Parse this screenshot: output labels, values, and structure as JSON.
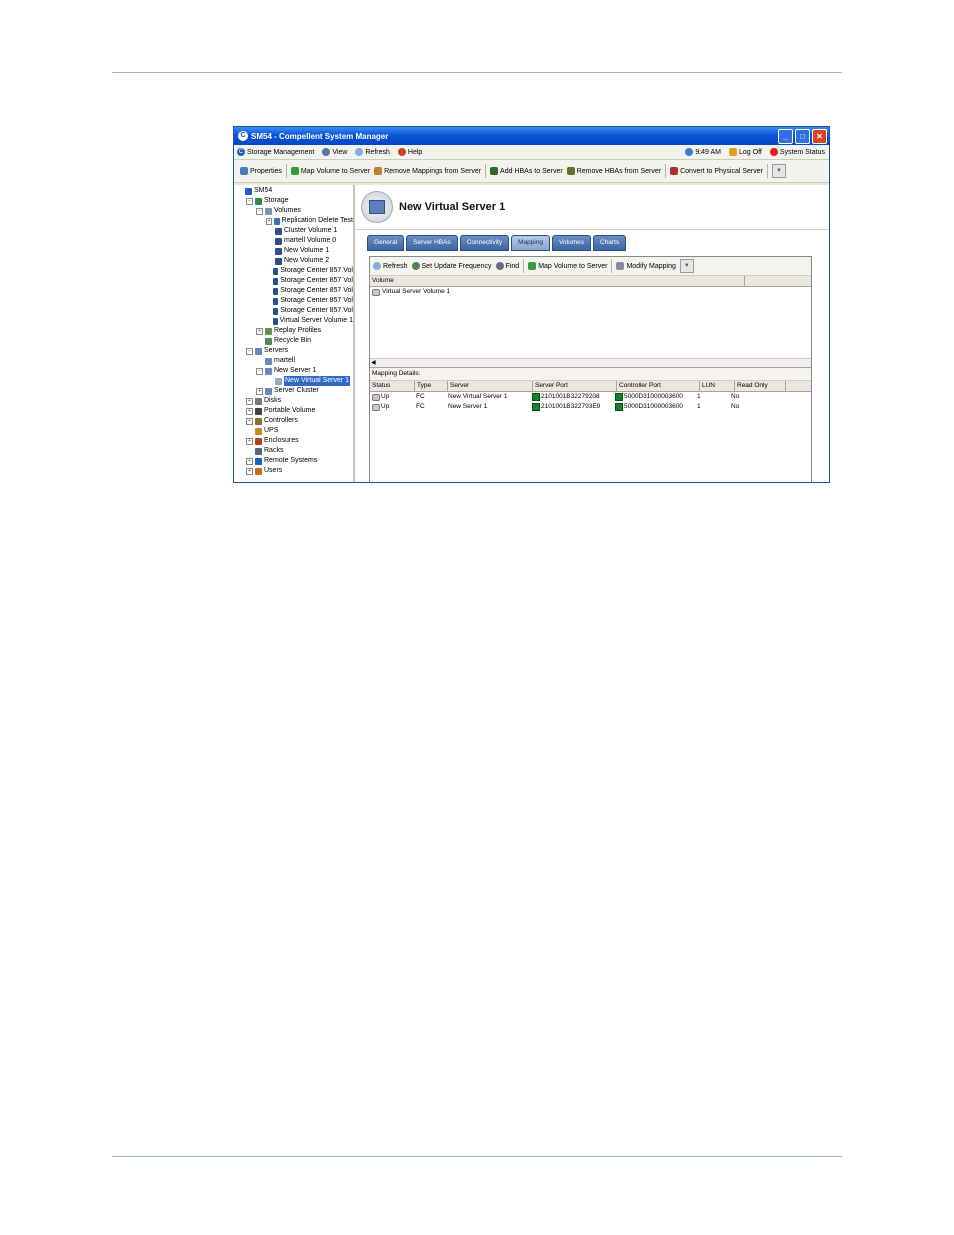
{
  "window": {
    "title": "SM54 - Compellent System Manager",
    "controls": [
      "_",
      "□",
      "✕"
    ]
  },
  "menubar": {
    "items": [
      "Storage Management",
      "View",
      "Refresh",
      "Help"
    ],
    "time": "9:49 AM",
    "logoff": "Log Off",
    "status": "System Status"
  },
  "toolbar": {
    "items": [
      "Properties",
      "Map Volume to Server",
      "Remove Mappings from Server",
      "Add HBAs to Server",
      "Remove HBAs from Server",
      "Convert to Physical Server"
    ]
  },
  "tree": {
    "nodes": [
      {
        "label": "SM54",
        "depth": 0,
        "exp": "",
        "icon": "#1b5fc2"
      },
      {
        "label": "Storage",
        "depth": 1,
        "exp": "−",
        "icon": "#2f8a3a"
      },
      {
        "label": "Volumes",
        "depth": 2,
        "exp": "−",
        "icon": "#7a93b8"
      },
      {
        "label": "Replication Delete Test",
        "depth": 3,
        "exp": "+",
        "icon": "#3b6fb6"
      },
      {
        "label": "Cluster Volume 1",
        "depth": 3,
        "exp": "",
        "icon": "#2b4f8c"
      },
      {
        "label": "martell Volume 0",
        "depth": 3,
        "exp": "",
        "icon": "#2b4f8c"
      },
      {
        "label": "New Volume 1",
        "depth": 3,
        "exp": "",
        "icon": "#2b4f8c"
      },
      {
        "label": "New Volume 2",
        "depth": 3,
        "exp": "",
        "icon": "#2b4f8c"
      },
      {
        "label": "Storage Center 857 Vol",
        "depth": 3,
        "exp": "",
        "icon": "#2b4f8c"
      },
      {
        "label": "Storage Center 857 Vol",
        "depth": 3,
        "exp": "",
        "icon": "#2b4f8c"
      },
      {
        "label": "Storage Center 857 Vol",
        "depth": 3,
        "exp": "",
        "icon": "#2b4f8c"
      },
      {
        "label": "Storage Center 857 Vol",
        "depth": 3,
        "exp": "",
        "icon": "#2b4f8c"
      },
      {
        "label": "Storage Center 857 Vol",
        "depth": 3,
        "exp": "",
        "icon": "#2b4f8c"
      },
      {
        "label": "Virtual Server Volume 1",
        "depth": 3,
        "exp": "",
        "icon": "#2b4f8c"
      },
      {
        "label": "Replay Profiles",
        "depth": 2,
        "exp": "+",
        "icon": "#6b8f4e"
      },
      {
        "label": "Recycle Bin",
        "depth": 2,
        "exp": "",
        "icon": "#4f8a4f"
      },
      {
        "label": "Servers",
        "depth": 1,
        "exp": "−",
        "icon": "#6b86b8"
      },
      {
        "label": "martell",
        "depth": 2,
        "exp": "",
        "icon": "#6b86b8"
      },
      {
        "label": "New Server 1",
        "depth": 2,
        "exp": "−",
        "icon": "#6b86b8"
      },
      {
        "label": "New Virtual Server 1",
        "depth": 3,
        "exp": "",
        "icon": "#9aa9c8",
        "selected": true
      },
      {
        "label": "Server Cluster",
        "depth": 2,
        "exp": "+",
        "icon": "#6b86b8"
      },
      {
        "label": "Disks",
        "depth": 1,
        "exp": "+",
        "icon": "#777777"
      },
      {
        "label": "Portable Volume",
        "depth": 1,
        "exp": "+",
        "icon": "#444444"
      },
      {
        "label": "Controllers",
        "depth": 1,
        "exp": "+",
        "icon": "#8a6b3a"
      },
      {
        "label": "UPS",
        "depth": 1,
        "exp": "",
        "icon": "#c09020"
      },
      {
        "label": "Enclosures",
        "depth": 1,
        "exp": "+",
        "icon": "#b04030"
      },
      {
        "label": "Racks",
        "depth": 1,
        "exp": "",
        "icon": "#556677"
      },
      {
        "label": "Remote Systems",
        "depth": 1,
        "exp": "+",
        "icon": "#1b5fc2"
      },
      {
        "label": "Users",
        "depth": 1,
        "exp": "+",
        "icon": "#c07020"
      }
    ]
  },
  "header": {
    "title": "New Virtual Server 1"
  },
  "tabs": [
    "General",
    "Server HBAs",
    "Connectivity",
    "Mapping",
    "Volumes",
    "Charts"
  ],
  "active_tab": "Mapping",
  "panel_toolbar": {
    "items": [
      "Refresh",
      "Set Update Frequency",
      "Find",
      "Map Volume to Server",
      "Modify Mapping"
    ]
  },
  "volumes": {
    "column": "Volume",
    "rows": [
      "Virtual Server Volume 1"
    ]
  },
  "mapping": {
    "title": "Mapping Details:",
    "columns": [
      "Status",
      "Type",
      "Server",
      "Server Port",
      "Controller Port",
      "LUN",
      "Read Only"
    ],
    "rows": [
      [
        "Up",
        "FC",
        "New Virtual Server 1",
        "2101001B32279208",
        "5000D31000003600",
        "1",
        "No"
      ],
      [
        "Up",
        "FC",
        "New Server 1",
        "2101001B322793E9",
        "5000D31000003600",
        "1",
        "No"
      ]
    ]
  }
}
